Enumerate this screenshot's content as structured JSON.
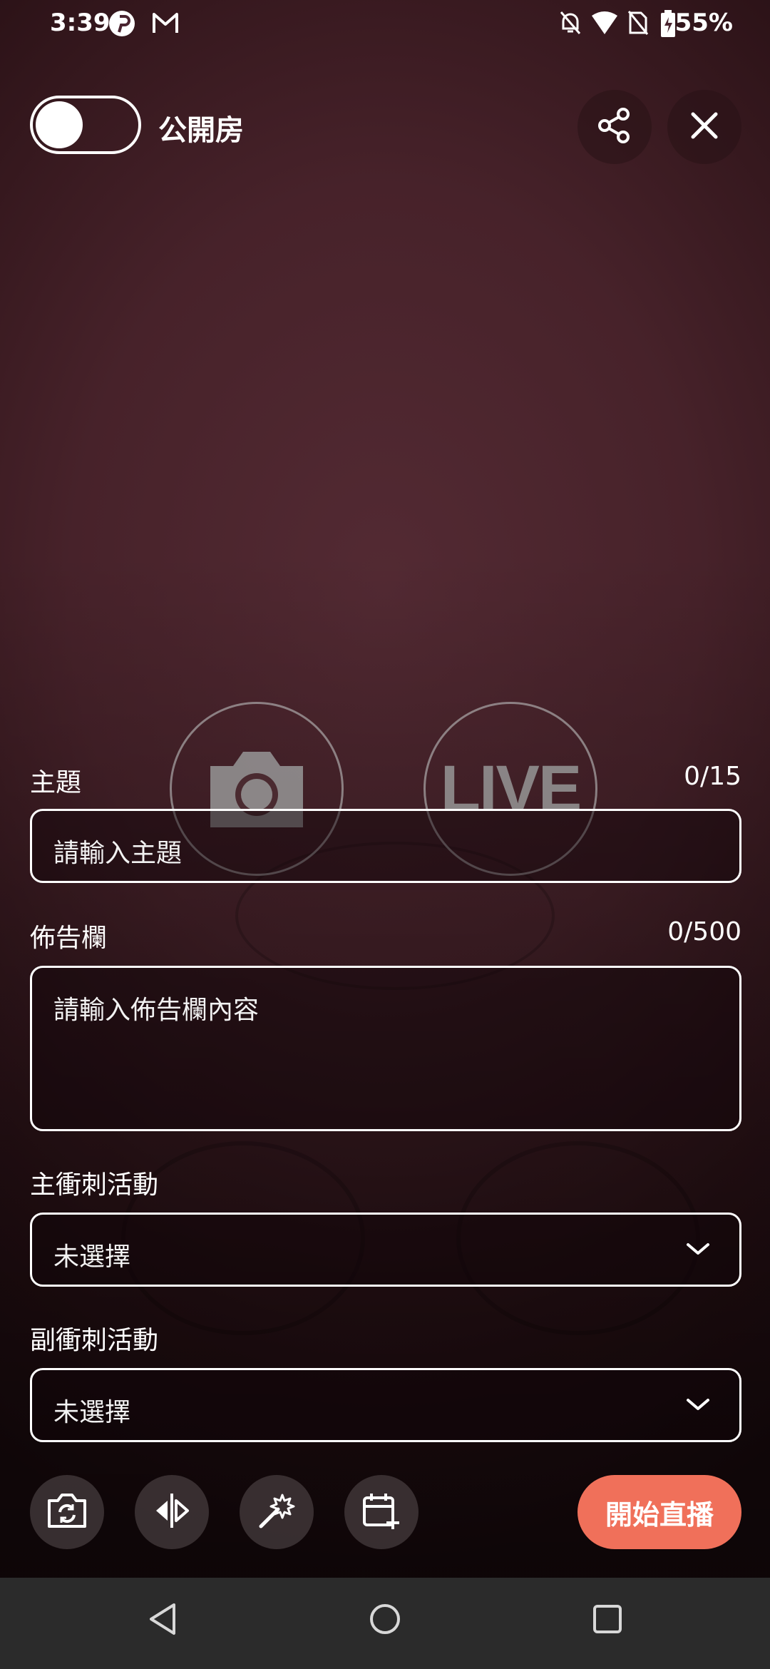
{
  "status_bar": {
    "time": "3:39",
    "battery": "55%",
    "icons": [
      "pinterest-icon",
      "gmail-icon",
      "bell-off-icon",
      "wifi-icon",
      "no-sim-icon",
      "battery-icon"
    ]
  },
  "header": {
    "toggle_label": "公開房",
    "toggle_on": false,
    "share_icon": "share-icon",
    "close_icon": "close-icon"
  },
  "overlay": {
    "camera_icon": "camera-icon",
    "live_label": "LIVE"
  },
  "form": {
    "topic": {
      "label": "主題",
      "counter": "0/15",
      "placeholder": "請輸入主題"
    },
    "bulletin": {
      "label": "佈告欄",
      "counter": "0/500",
      "placeholder": "請輸入佈告欄內容"
    },
    "main_campaign": {
      "label": "主衝刺活動",
      "value": "未選擇"
    },
    "sub_campaign": {
      "label": "副衝刺活動",
      "value": "未選擇"
    }
  },
  "toolbar": {
    "tools": [
      "camera-switch-icon",
      "mirror-icon",
      "beauty-wand-icon",
      "calendar-add-icon"
    ],
    "start_label": "開始直播",
    "start_color": "#f0705a"
  },
  "nav_bar": {
    "buttons": [
      "back-icon",
      "home-icon",
      "recents-icon"
    ]
  }
}
